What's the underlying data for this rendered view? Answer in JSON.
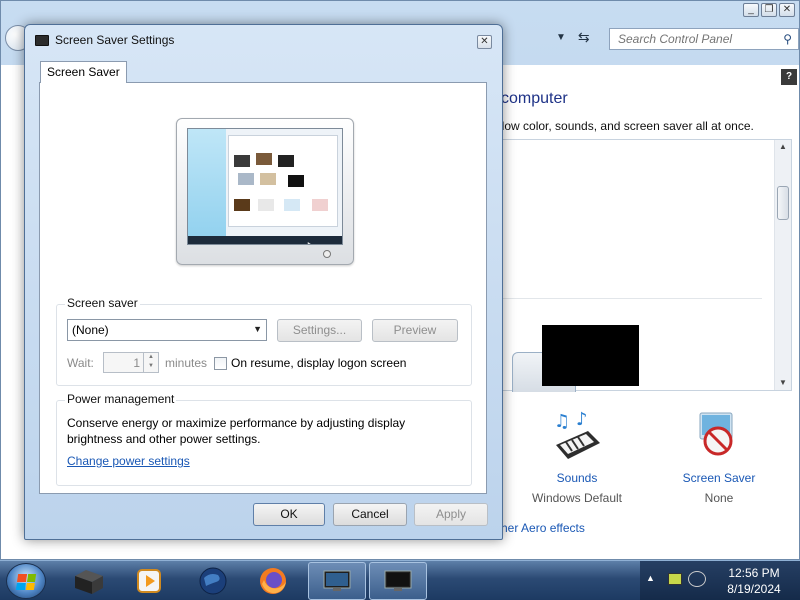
{
  "background_window": {
    "search_placeholder": "Search Control Panel",
    "heading": "computer",
    "subheading": "ndow color, sounds, and screen saver all at once.",
    "sounds": {
      "label": "Sounds",
      "value": "Windows Default"
    },
    "screen_saver": {
      "label": "Screen Saver",
      "value": "None"
    },
    "aero_link": "her Aero effects"
  },
  "dialog": {
    "title": "Screen Saver Settings",
    "tab_label": "Screen Saver",
    "screen_saver_group": {
      "legend": "Screen saver",
      "selected_value": "(None)",
      "settings_button": "Settings...",
      "preview_button": "Preview",
      "wait_label": "Wait:",
      "wait_value": "1",
      "minutes_label": "minutes",
      "logon_checkbox_label": "On resume, display logon screen"
    },
    "power_group": {
      "legend": "Power management",
      "description": "Conserve energy or maximize performance by adjusting display brightness and other power settings.",
      "link": "Change power settings"
    },
    "buttons": {
      "ok": "OK",
      "cancel": "Cancel",
      "apply": "Apply"
    }
  },
  "taskbar": {
    "time": "12:56 PM",
    "date": "8/19/2024",
    "items": [
      "media-center-icon",
      "media-player-icon",
      "globe-icon",
      "firefox-icon",
      "screen-saver-window-icon",
      "control-panel-window-icon"
    ]
  }
}
